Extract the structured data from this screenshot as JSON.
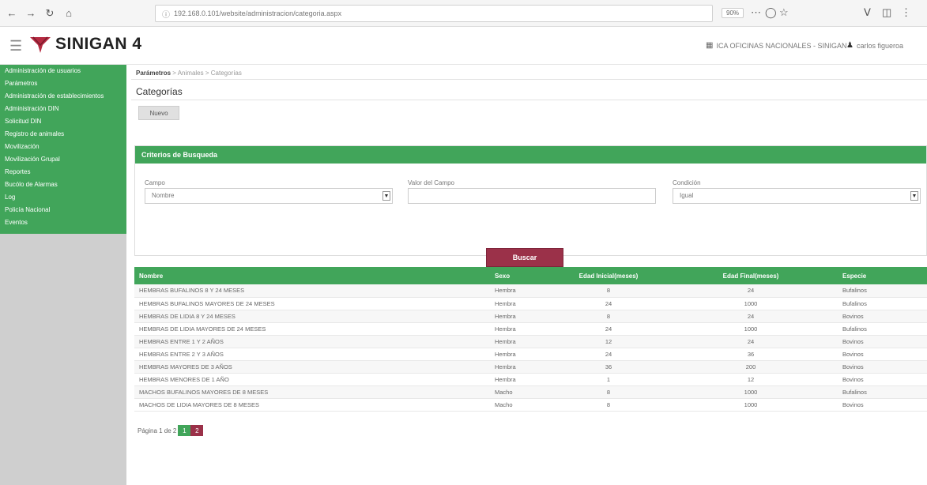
{
  "browser": {
    "url": "192.168.0.101/website/administracion/categoria.aspx",
    "zoom": "90%",
    "back_icon": "arrow-left-icon",
    "forward_icon": "arrow-right-icon"
  },
  "header": {
    "brand": "SINIGAN 4",
    "org": "ICA OFICINAS NACIONALES - SINIGAN",
    "user": "carlos figueroa"
  },
  "sidebar": {
    "items": [
      {
        "label": "Administración de usuarios"
      },
      {
        "label": "Parámetros"
      },
      {
        "label": "Administración de establecimientos"
      },
      {
        "label": "Administración DIN"
      },
      {
        "label": "Solicitud DIN"
      },
      {
        "label": "Registro de animales"
      },
      {
        "label": "Movilización"
      },
      {
        "label": "Movilización Grupal"
      },
      {
        "label": "Reportes"
      },
      {
        "label": "Bucólo de Alarmas"
      },
      {
        "label": "Log"
      },
      {
        "label": "Policía Nacional"
      },
      {
        "label": "Eventos"
      }
    ]
  },
  "main": {
    "breadcrumb": {
      "root": "Parámetros",
      "sep1": " > ",
      "mid": "Animales",
      "sep2": " > ",
      "current": "Categorías"
    },
    "title": "Categorías",
    "new_button": "Nuevo",
    "search_panel": {
      "title": "Criterios de Busqueda",
      "field_label": "Campo",
      "field_value": "Nombre",
      "value_label": "Valor del Campo",
      "value_input": "",
      "condition_label": "Condición",
      "condition_value": "Igual",
      "search_button": "Buscar"
    },
    "table": {
      "headers": [
        "Nombre",
        "Sexo",
        "Edad Inicial(meses)",
        "Edad Final(meses)",
        "Especie"
      ],
      "rows": [
        [
          "HEMBRAS BUFALINOS 8 Y 24 MESES",
          "Hembra",
          "8",
          "24",
          "Bufalinos"
        ],
        [
          "HEMBRAS BUFALINOS MAYORES DE 24 MESES",
          "Hembra",
          "24",
          "1000",
          "Bufalinos"
        ],
        [
          "HEMBRAS DE LIDIA 8 Y 24 MESES",
          "Hembra",
          "8",
          "24",
          "Bovinos"
        ],
        [
          "HEMBRAS DE LIDIA MAYORES DE 24 MESES",
          "Hembra",
          "24",
          "1000",
          "Bufalinos"
        ],
        [
          "HEMBRAS ENTRE 1 Y 2 AÑOS",
          "Hembra",
          "12",
          "24",
          "Bovinos"
        ],
        [
          "HEMBRAS ENTRE 2 Y 3 AÑOS",
          "Hembra",
          "24",
          "36",
          "Bovinos"
        ],
        [
          "HEMBRAS MAYORES DE 3 AÑOS",
          "Hembra",
          "36",
          "200",
          "Bovinos"
        ],
        [
          "HEMBRAS MENORES DE 1 AÑO",
          "Hembra",
          "1",
          "12",
          "Bovinos"
        ],
        [
          "MACHOS BUFALINOS MAYORES DE 8 MESES",
          "Macho",
          "8",
          "1000",
          "Bufalinos"
        ],
        [
          "MACHOS DE LIDIA MAYORES DE 8 MESES",
          "Macho",
          "8",
          "1000",
          "Bovinos"
        ]
      ]
    },
    "pager": {
      "text": "Página 1 de 2",
      "first": "1",
      "next": "2"
    }
  },
  "colors": {
    "green": "#41a55a",
    "maroon": "#9b3149"
  }
}
